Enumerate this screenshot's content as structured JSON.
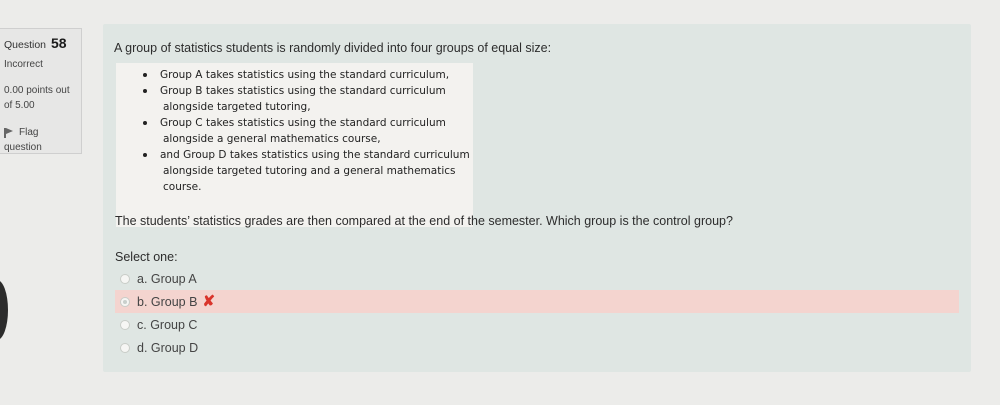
{
  "info": {
    "question_label": "Question",
    "question_number": "58",
    "state": "Incorrect",
    "grade_line1": "0.00 points out",
    "grade_line2": "of 5.00",
    "flag_label_line1": "Flag",
    "flag_label_line2": "question"
  },
  "question": {
    "prompt": "A group of statistics students is randomly divided into four groups of equal size:",
    "groups": [
      {
        "lines": [
          "Group A takes statistics using the standard curriculum,"
        ]
      },
      {
        "lines": [
          "Group B takes statistics using the standard curriculum",
          "alongside targeted tutoring,"
        ]
      },
      {
        "lines": [
          "Group C takes statistics using the standard curriculum",
          "alongside a general mathematics course,"
        ]
      },
      {
        "lines": [
          "and Group D takes statistics using the standard curriculum",
          "alongside targeted tutoring and a general mathematics",
          "course."
        ]
      }
    ],
    "text": "The students’ statistics grades are then compared at the end of the semester. Which group is the control group?",
    "select_label": "Select one:"
  },
  "answers": [
    {
      "label": "a. Group A",
      "selected": false,
      "incorrect": false
    },
    {
      "label": "b. Group B",
      "selected": true,
      "incorrect": true,
      "mark": "✘"
    },
    {
      "label": "c. Group C",
      "selected": false,
      "incorrect": false
    },
    {
      "label": "d. Group D",
      "selected": false,
      "incorrect": false
    }
  ],
  "colors": {
    "incorrect_bg": "#f4d4cf",
    "incorrect_mark": "#d9342b",
    "question_bg": "#dfe6e3"
  }
}
